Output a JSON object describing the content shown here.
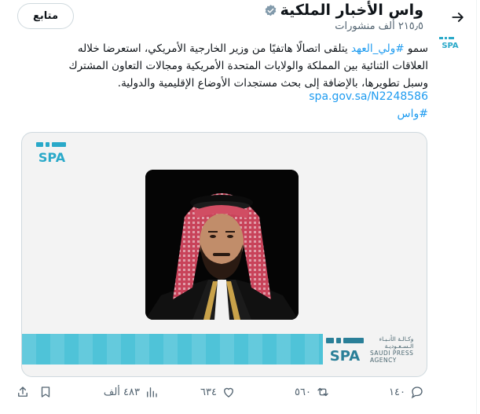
{
  "header": {
    "title": "واس الأخبار الملكية",
    "subtitle": "٢١٥٫٥ ألف منشورات",
    "results_button": "متابع"
  },
  "tweet": {
    "text_prefix": "سمو ",
    "mention": "#ولي_العهد",
    "text_rest": " يتلقى اتصالًا هاتفيًا من وزير الخارجية الأمريكي، استعرضا خلاله العلاقات الثنائية بين المملكة والولايات المتحدة الأمريكية ومجالات التعاون المشترك وسبل تطويرها، بالإضافة إلى بحث مستجدات الأوضاع الإقليمية والدولية.",
    "link": "spa.gov.sa/N2248586",
    "hashtag": "#واس"
  },
  "media": {
    "logo_text": "SPA",
    "agency_ar_line1": "وكـالـة الأنـبـاء",
    "agency_ar_line2": "الـسـعـوديـة",
    "agency_en_line1": "SAUDI PRESS",
    "agency_en_line2": "AGENCY",
    "stripe_color": "#4fc3d8"
  },
  "actions": {
    "replies": "١٤٠",
    "reposts": "٥٦٠",
    "likes": "٦٣٤",
    "views": "٤٨٣ ألف"
  },
  "colors": {
    "accent": "#1d9bf0",
    "secondary_text": "#536471",
    "verified": "#829aab"
  }
}
